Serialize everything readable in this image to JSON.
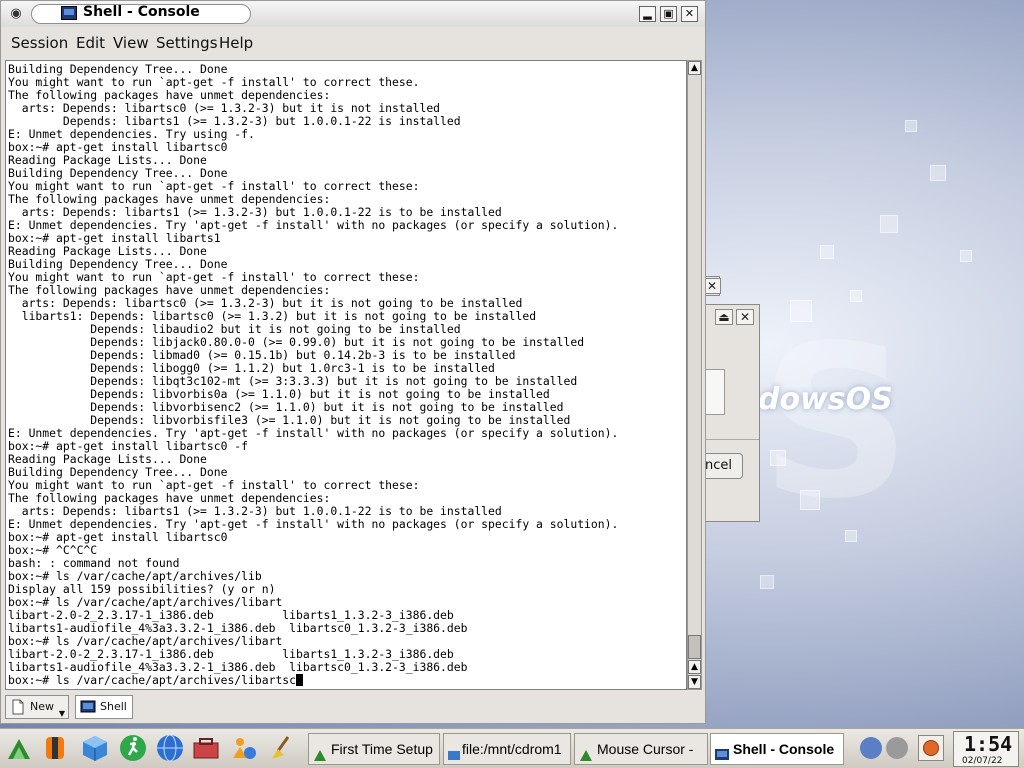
{
  "window": {
    "title": "Shell - Console",
    "minimize_glyph": "▂",
    "maximize_glyph": "▣",
    "close_glyph": "✕"
  },
  "menu": {
    "session": "Session",
    "edit": "Edit",
    "view": "View",
    "settings": "Settings",
    "help": "Help"
  },
  "terminal": {
    "lines": [
      "Building Dependency Tree... Done",
      "You might want to run `apt-get -f install' to correct these.",
      "The following packages have unmet dependencies:",
      "  arts: Depends: libartsc0 (>= 1.3.2-3) but it is not installed",
      "        Depends: libarts1 (>= 1.3.2-3) but 1.0.0.1-22 is installed",
      "E: Unmet dependencies. Try using -f.",
      "box:~# apt-get install libartsc0",
      "Reading Package Lists... Done",
      "Building Dependency Tree... Done",
      "You might want to run `apt-get -f install' to correct these:",
      "The following packages have unmet dependencies:",
      "  arts: Depends: libarts1 (>= 1.3.2-3) but 1.0.0.1-22 is to be installed",
      "E: Unmet dependencies. Try 'apt-get -f install' with no packages (or specify a solution).",
      "box:~# apt-get install libarts1",
      "Reading Package Lists... Done",
      "Building Dependency Tree... Done",
      "You might want to run `apt-get -f install' to correct these:",
      "The following packages have unmet dependencies:",
      "  arts: Depends: libartsc0 (>= 1.3.2-3) but it is not going to be installed",
      "  libarts1: Depends: libartsc0 (>= 1.3.2) but it is not going to be installed",
      "            Depends: libaudio2 but it is not going to be installed",
      "            Depends: libjack0.80.0-0 (>= 0.99.0) but it is not going to be installed",
      "            Depends: libmad0 (>= 0.15.1b) but 0.14.2b-3 is to be installed",
      "            Depends: libogg0 (>= 1.1.2) but 1.0rc3-1 is to be installed",
      "            Depends: libqt3c102-mt (>= 3:3.3.3) but it is not going to be installed",
      "            Depends: libvorbis0a (>= 1.1.0) but it is not going to be installed",
      "            Depends: libvorbisenc2 (>= 1.1.0) but it is not going to be installed",
      "            Depends: libvorbisfile3 (>= 1.1.0) but it is not going to be installed",
      "E: Unmet dependencies. Try 'apt-get -f install' with no packages (or specify a solution).",
      "box:~# apt-get install libartsc0 -f",
      "Reading Package Lists... Done",
      "Building Dependency Tree... Done",
      "You might want to run `apt-get -f install' to correct these:",
      "The following packages have unmet dependencies:",
      "  arts: Depends: libarts1 (>= 1.3.2-3) but 1.0.0.1-22 is to be installed",
      "E: Unmet dependencies. Try 'apt-get -f install' with no packages (or specify a solution).",
      "box:~# apt-get install libartsc0",
      "box:~# ^C^C^C",
      "bash: : command not found",
      "box:~# ls /var/cache/apt/archives/lib",
      "Display all 159 possibilities? (y or n)",
      "box:~# ls /var/cache/apt/archives/libart",
      "libart-2.0-2_2.3.17-1_i386.deb          libarts1_1.3.2-3_i386.deb",
      "libarts1-audiofile_4%3a3.3.2-1_i386.deb  libartsc0_1.3.2-3_i386.deb",
      "box:~# ls /var/cache/apt/archives/libart",
      "libart-2.0-2_2.3.17-1_i386.deb          libarts1_1.3.2-3_i386.deb",
      "libarts1-audiofile_4%3a3.3.2-1_i386.deb  libartsc0_1.3.2-3_i386.deb"
    ],
    "prompt_line": "box:~# ls /var/cache/apt/archives/libartsc"
  },
  "tabs": {
    "new": "New",
    "shell": "Shell"
  },
  "taskbar": {
    "tasks": [
      "First Time Setup",
      "file:/mnt/cdrom1",
      "Mouse Cursor -",
      "Shell - Console"
    ],
    "clock_time": "1:54",
    "clock_date": "02/07/22"
  },
  "desktop": {
    "logo_text": "dowsOS",
    "bg_dialog_button": "ncel"
  },
  "colors": {
    "terminal_bg": "#ffffff",
    "terminal_fg": "#000000",
    "window_chrome": "#e6e3de"
  }
}
